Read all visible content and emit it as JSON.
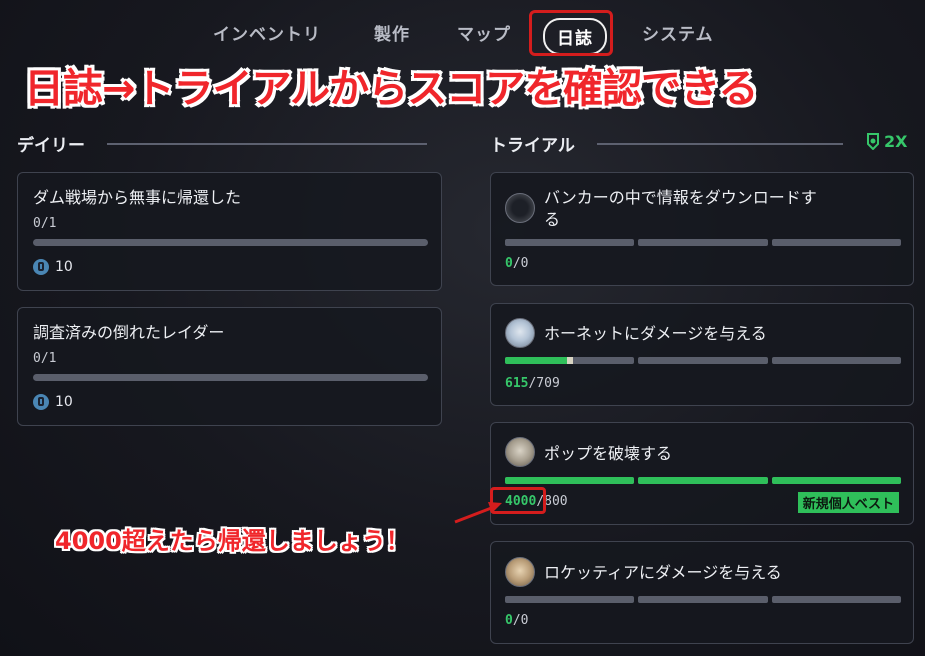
{
  "tabs": [
    {
      "label": "インベントリ"
    },
    {
      "label": "製作"
    },
    {
      "label": "マップ"
    },
    {
      "label": "日誌",
      "active": true
    },
    {
      "label": "システム"
    }
  ],
  "banner_text": "日誌→トライアルからスコアを確認できる",
  "daily": {
    "title": "デイリー",
    "items": [
      {
        "title": "ダム戦場から無事に帰還した",
        "progress": "0/1",
        "reward": "10"
      },
      {
        "title": "調査済みの倒れたレイダー",
        "progress": "0/1",
        "reward": "10"
      }
    ]
  },
  "trial": {
    "title": "トライアル",
    "multiplier": "2X",
    "items": [
      {
        "title_line1": "バンカーの中で情報をダウンロードす",
        "title_line2": "る",
        "current": "0",
        "total": "/0",
        "thumb": "bunker-thumb"
      },
      {
        "title": "ホーネットにダメージを与える",
        "current": "615",
        "total": "/709",
        "thumb": "hornet-thumb"
      },
      {
        "title": "ポップを破壊する",
        "current": "4000",
        "total": "/800",
        "badge": "新規個人ベスト",
        "thumb": "pop-thumb"
      },
      {
        "title": "ロケッティアにダメージを与える",
        "current": "0",
        "total": "/0",
        "thumb": "rocketeer-thumb"
      }
    ]
  },
  "callout_text": "4000超えたら帰還しましょう！",
  "colors": {
    "accent_green": "#2fbf5a",
    "annotation_red": "#d41d1d",
    "coin_blue": "#4a86b4"
  },
  "icons": [
    "coin-icon",
    "shield-badge-icon",
    "arrow-icon"
  ]
}
